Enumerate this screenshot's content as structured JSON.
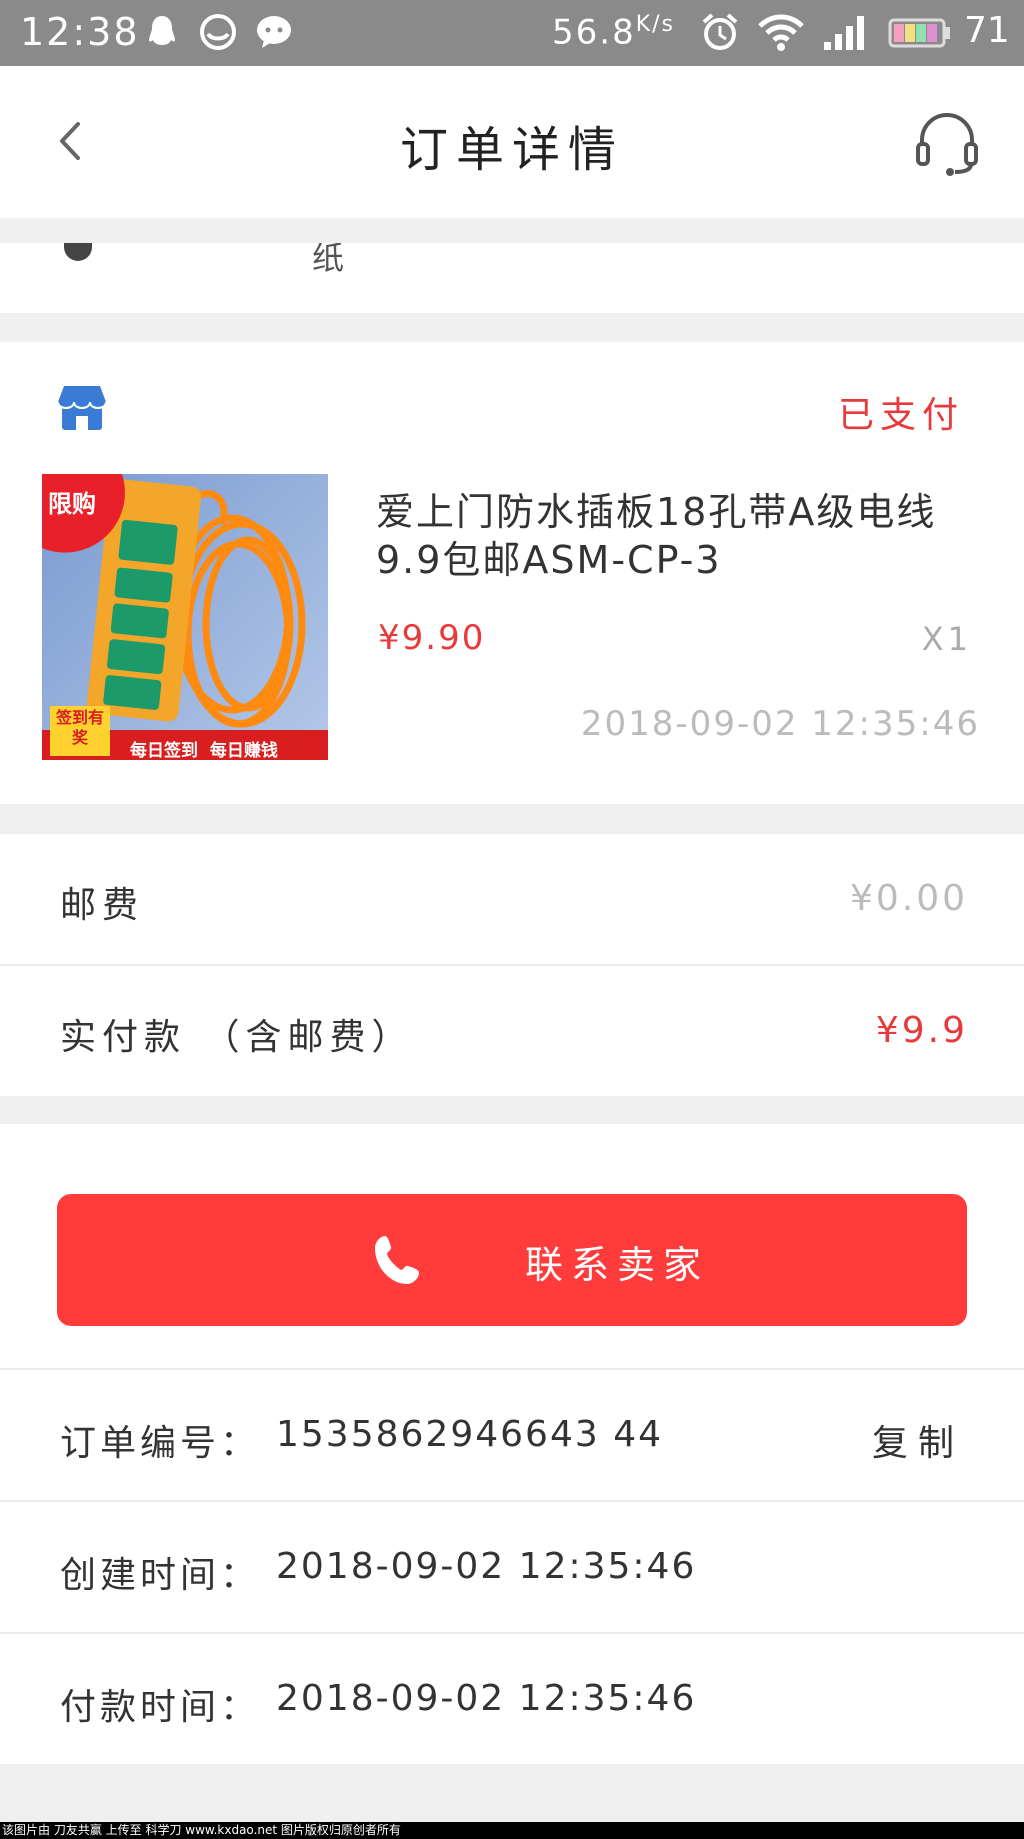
{
  "status_bar": {
    "time": "12:38",
    "speed": "56.8",
    "speed_unit": "K/s",
    "battery": "71",
    "icons": [
      "qq-icon",
      "browser-icon",
      "wechat-icon",
      "alarm-icon",
      "wifi-icon",
      "signal-icon",
      "battery-icon"
    ]
  },
  "nav": {
    "title": "订单详情",
    "back_icon": "chevron-left-icon",
    "service_icon": "headset-icon"
  },
  "address": {
    "fragment": "纸"
  },
  "order": {
    "status": "已支付",
    "product": {
      "name": "爱上门防水插板18孔带A级电线9.9包邮ASM-CP-3",
      "price": "¥9.90",
      "quantity": "X1",
      "time": "2018-09-02 12:35:46",
      "image": {
        "badge": "限购",
        "sign_badge": "签到有奖",
        "banner": "每日签到  每日赚钱"
      }
    }
  },
  "fees": {
    "shipping_label": "邮费",
    "shipping_value": "¥0.00",
    "total_label": "实付款 （含邮费）",
    "total_value": "¥9.9"
  },
  "contact": {
    "button_label": "联系卖家"
  },
  "info": {
    "order_no_label": "订单编号：",
    "order_no_value": "1535862946643 44",
    "copy_label": "复制",
    "created_label": "创建时间：",
    "created_value": "2018-09-02 12:35:46",
    "paid_label": "付款时间：",
    "paid_value": "2018-09-02 12:35:46"
  },
  "watermark": "该图片由 刀友共赢 上传至 科学刀 www.kxdao.net 图片版权归原创者所有",
  "colors": {
    "accent": "#ff3b3b",
    "status_red": "#e83a3a",
    "status_bar": "#8a8a8a",
    "shop_icon": "#3a7bd5"
  }
}
